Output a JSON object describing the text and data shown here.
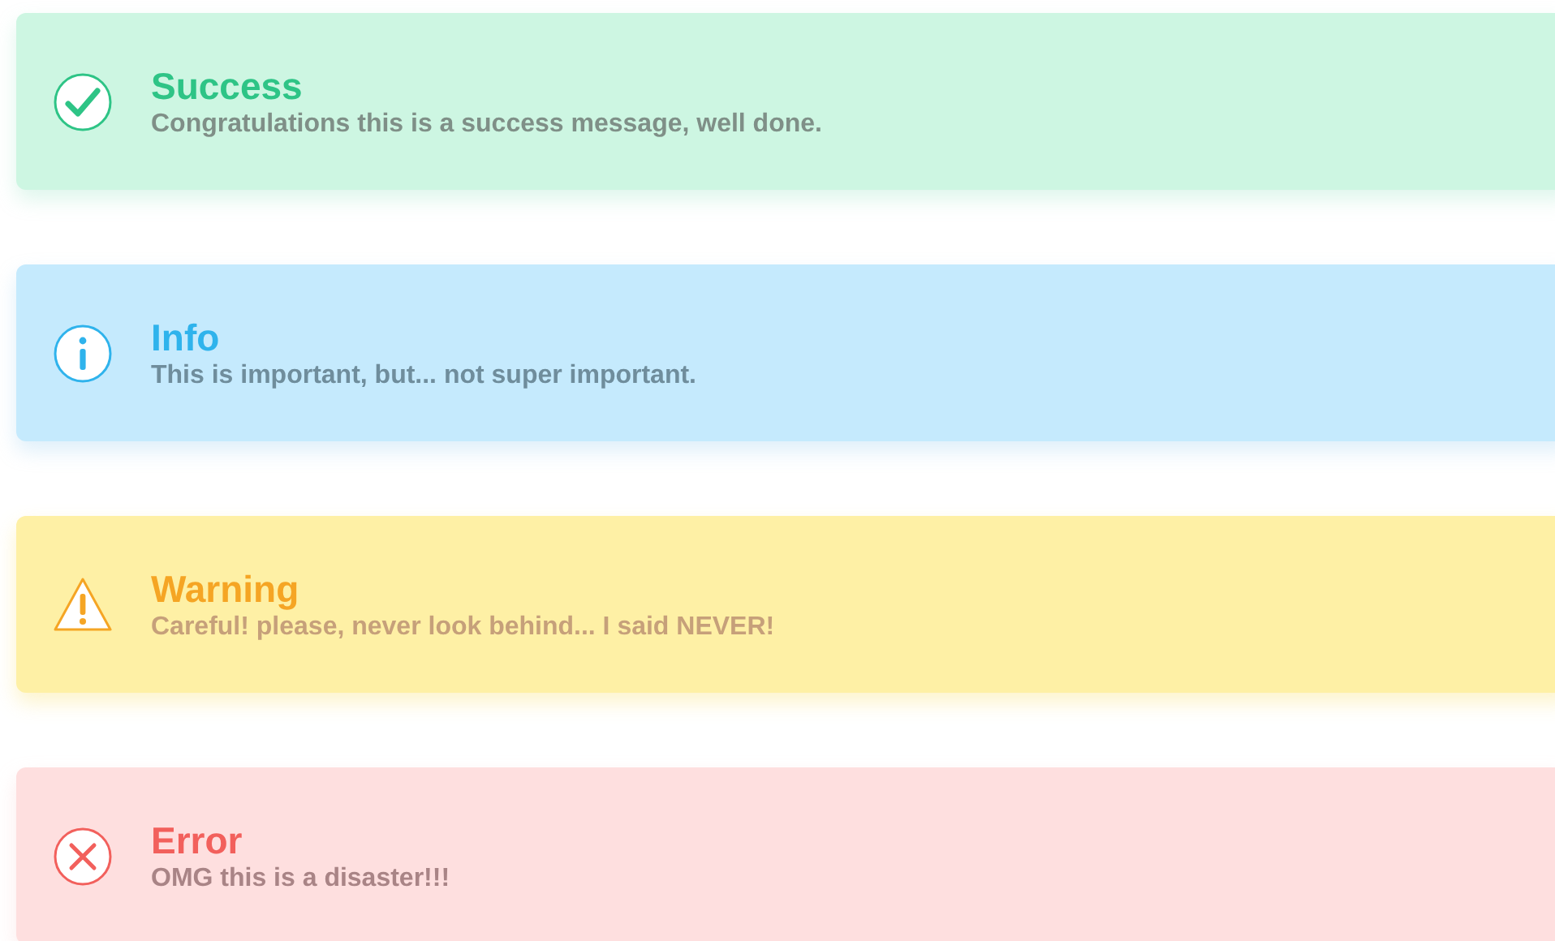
{
  "alerts": [
    {
      "kind": "success",
      "title": "Success",
      "message": "Congratulations this is a success message, well done."
    },
    {
      "kind": "info",
      "title": "Info",
      "message": "This is important, but... not super important."
    },
    {
      "kind": "warning",
      "title": "Warning",
      "message": "Careful! please, never look behind... I said NEVER!"
    },
    {
      "kind": "error",
      "title": "Error",
      "message": "OMG this is a disaster!!!"
    }
  ]
}
